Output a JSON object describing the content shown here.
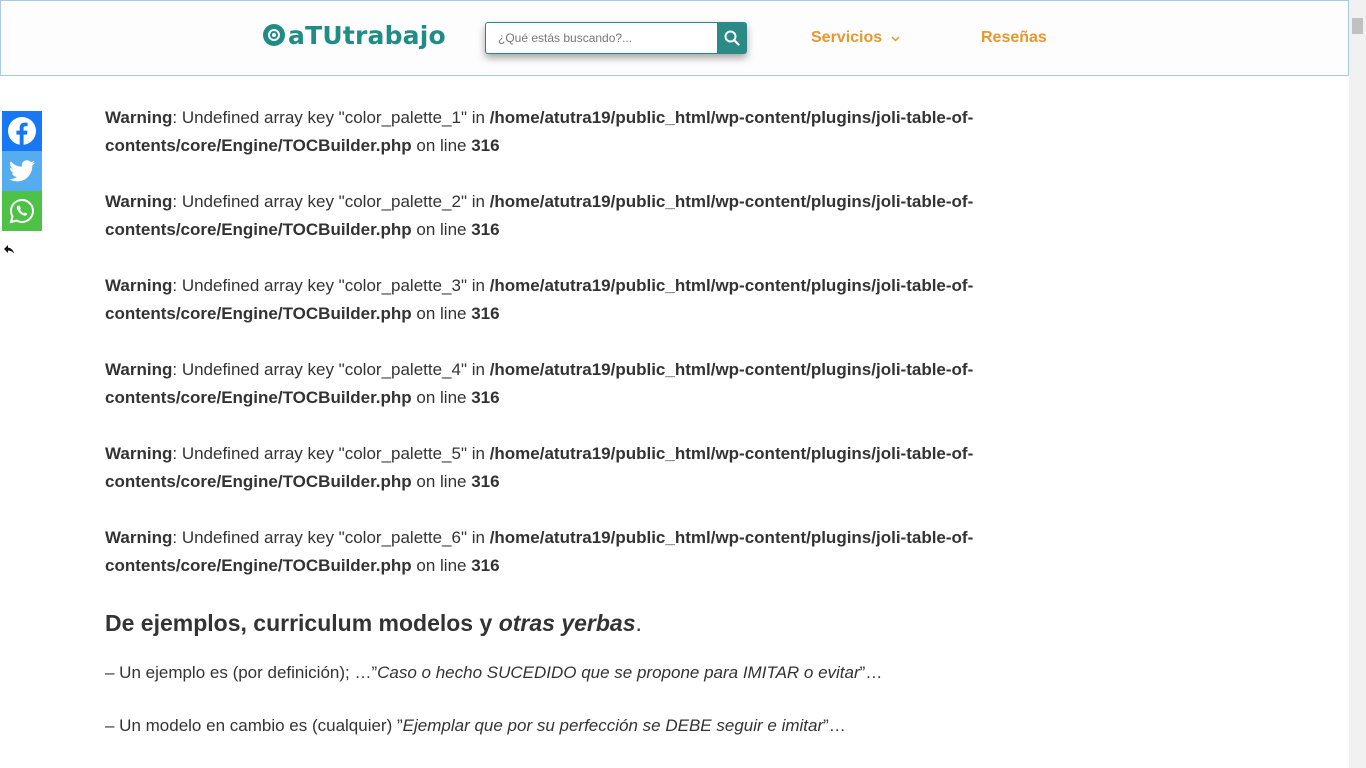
{
  "header": {
    "logo_text": "aTUtrabajo",
    "search": {
      "placeholder": "¿Qué estás buscando?...",
      "value": ""
    },
    "nav": [
      {
        "label": "Servicios",
        "has_dropdown": true
      },
      {
        "label": "Reseñas",
        "has_dropdown": false
      }
    ]
  },
  "social": [
    {
      "name": "facebook-icon"
    },
    {
      "name": "twitter-icon"
    },
    {
      "name": "whatsapp-icon"
    }
  ],
  "warnings": [
    {
      "label": "Warning",
      "message": ": Undefined array key \"color_palette_1\" in ",
      "path": "/home/atutra19/public_html/wp-content/plugins/joli-table-of-contents/core/Engine/TOCBuilder.php",
      "online": " on line ",
      "line": "316"
    },
    {
      "label": "Warning",
      "message": ": Undefined array key \"color_palette_2\" in ",
      "path": "/home/atutra19/public_html/wp-content/plugins/joli-table-of-contents/core/Engine/TOCBuilder.php",
      "online": " on line ",
      "line": "316"
    },
    {
      "label": "Warning",
      "message": ": Undefined array key \"color_palette_3\" in ",
      "path": "/home/atutra19/public_html/wp-content/plugins/joli-table-of-contents/core/Engine/TOCBuilder.php",
      "online": " on line ",
      "line": "316"
    },
    {
      "label": "Warning",
      "message": ": Undefined array key \"color_palette_4\" in ",
      "path": "/home/atutra19/public_html/wp-content/plugins/joli-table-of-contents/core/Engine/TOCBuilder.php",
      "online": " on line ",
      "line": "316"
    },
    {
      "label": "Warning",
      "message": ": Undefined array key \"color_palette_5\" in ",
      "path": "/home/atutra19/public_html/wp-content/plugins/joli-table-of-contents/core/Engine/TOCBuilder.php",
      "online": " on line ",
      "line": "316"
    },
    {
      "label": "Warning",
      "message": ": Undefined array key \"color_palette_6\" in ",
      "path": "/home/atutra19/public_html/wp-content/plugins/joli-table-of-contents/core/Engine/TOCBuilder.php",
      "online": " on line ",
      "line": "316"
    }
  ],
  "article": {
    "heading_main": "De ejemplos, curriculum modelos y ",
    "heading_em": "otras yerbas",
    "heading_end": ".",
    "para1_pre": "– Un ejemplo es (por definición); …”",
    "para1_it": "Caso o hecho SUCEDIDO que se propone para IMITAR o evitar",
    "para1_post": "”…",
    "para2_pre": "– Un modelo en cambio es (cualquier) ”",
    "para2_it": "Ejemplar que por su perfección se DEBE seguir e imitar",
    "para2_post": "”…"
  },
  "colors": {
    "accent": "#1f8c86",
    "nav": "#e8962e",
    "facebook": "#1877f2",
    "twitter": "#55acee",
    "whatsapp": "#4dc247"
  }
}
